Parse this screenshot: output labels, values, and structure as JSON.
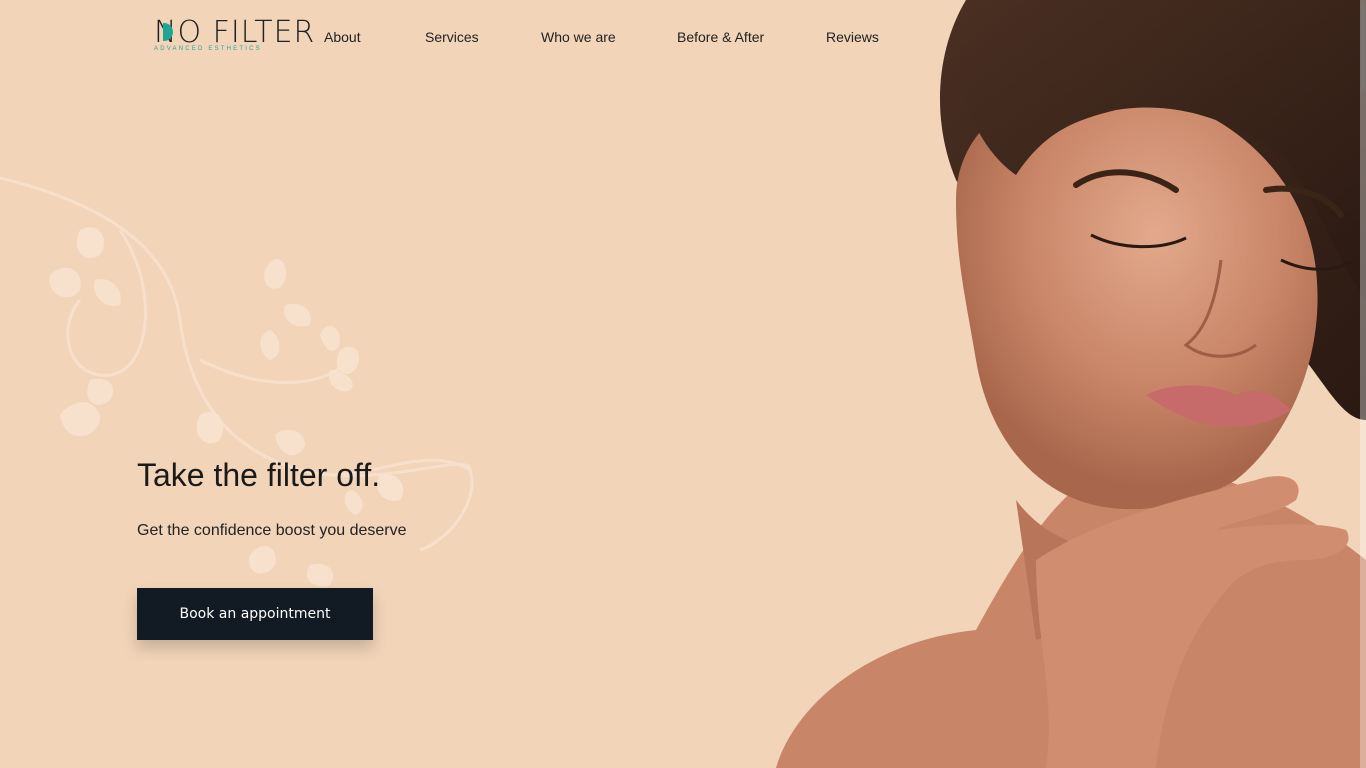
{
  "brand": {
    "name": "NO FILTER",
    "tagline": "ADVANCED ESTHETICS",
    "accent_color": "#1fa596"
  },
  "nav": {
    "items": [
      {
        "label": "About"
      },
      {
        "label": "Services"
      },
      {
        "label": "Who we are"
      },
      {
        "label": "Before & After"
      },
      {
        "label": "Reviews"
      }
    ]
  },
  "hero": {
    "title": "Take the filter off.",
    "subtitle": "Get the confidence boost you deserve",
    "cta_label": "Book an appointment",
    "background_color": "#f2d4b8",
    "cta_color": "#121a24"
  },
  "icons": {
    "vine": "decorative-vine-icon",
    "portrait": "portrait-image"
  }
}
